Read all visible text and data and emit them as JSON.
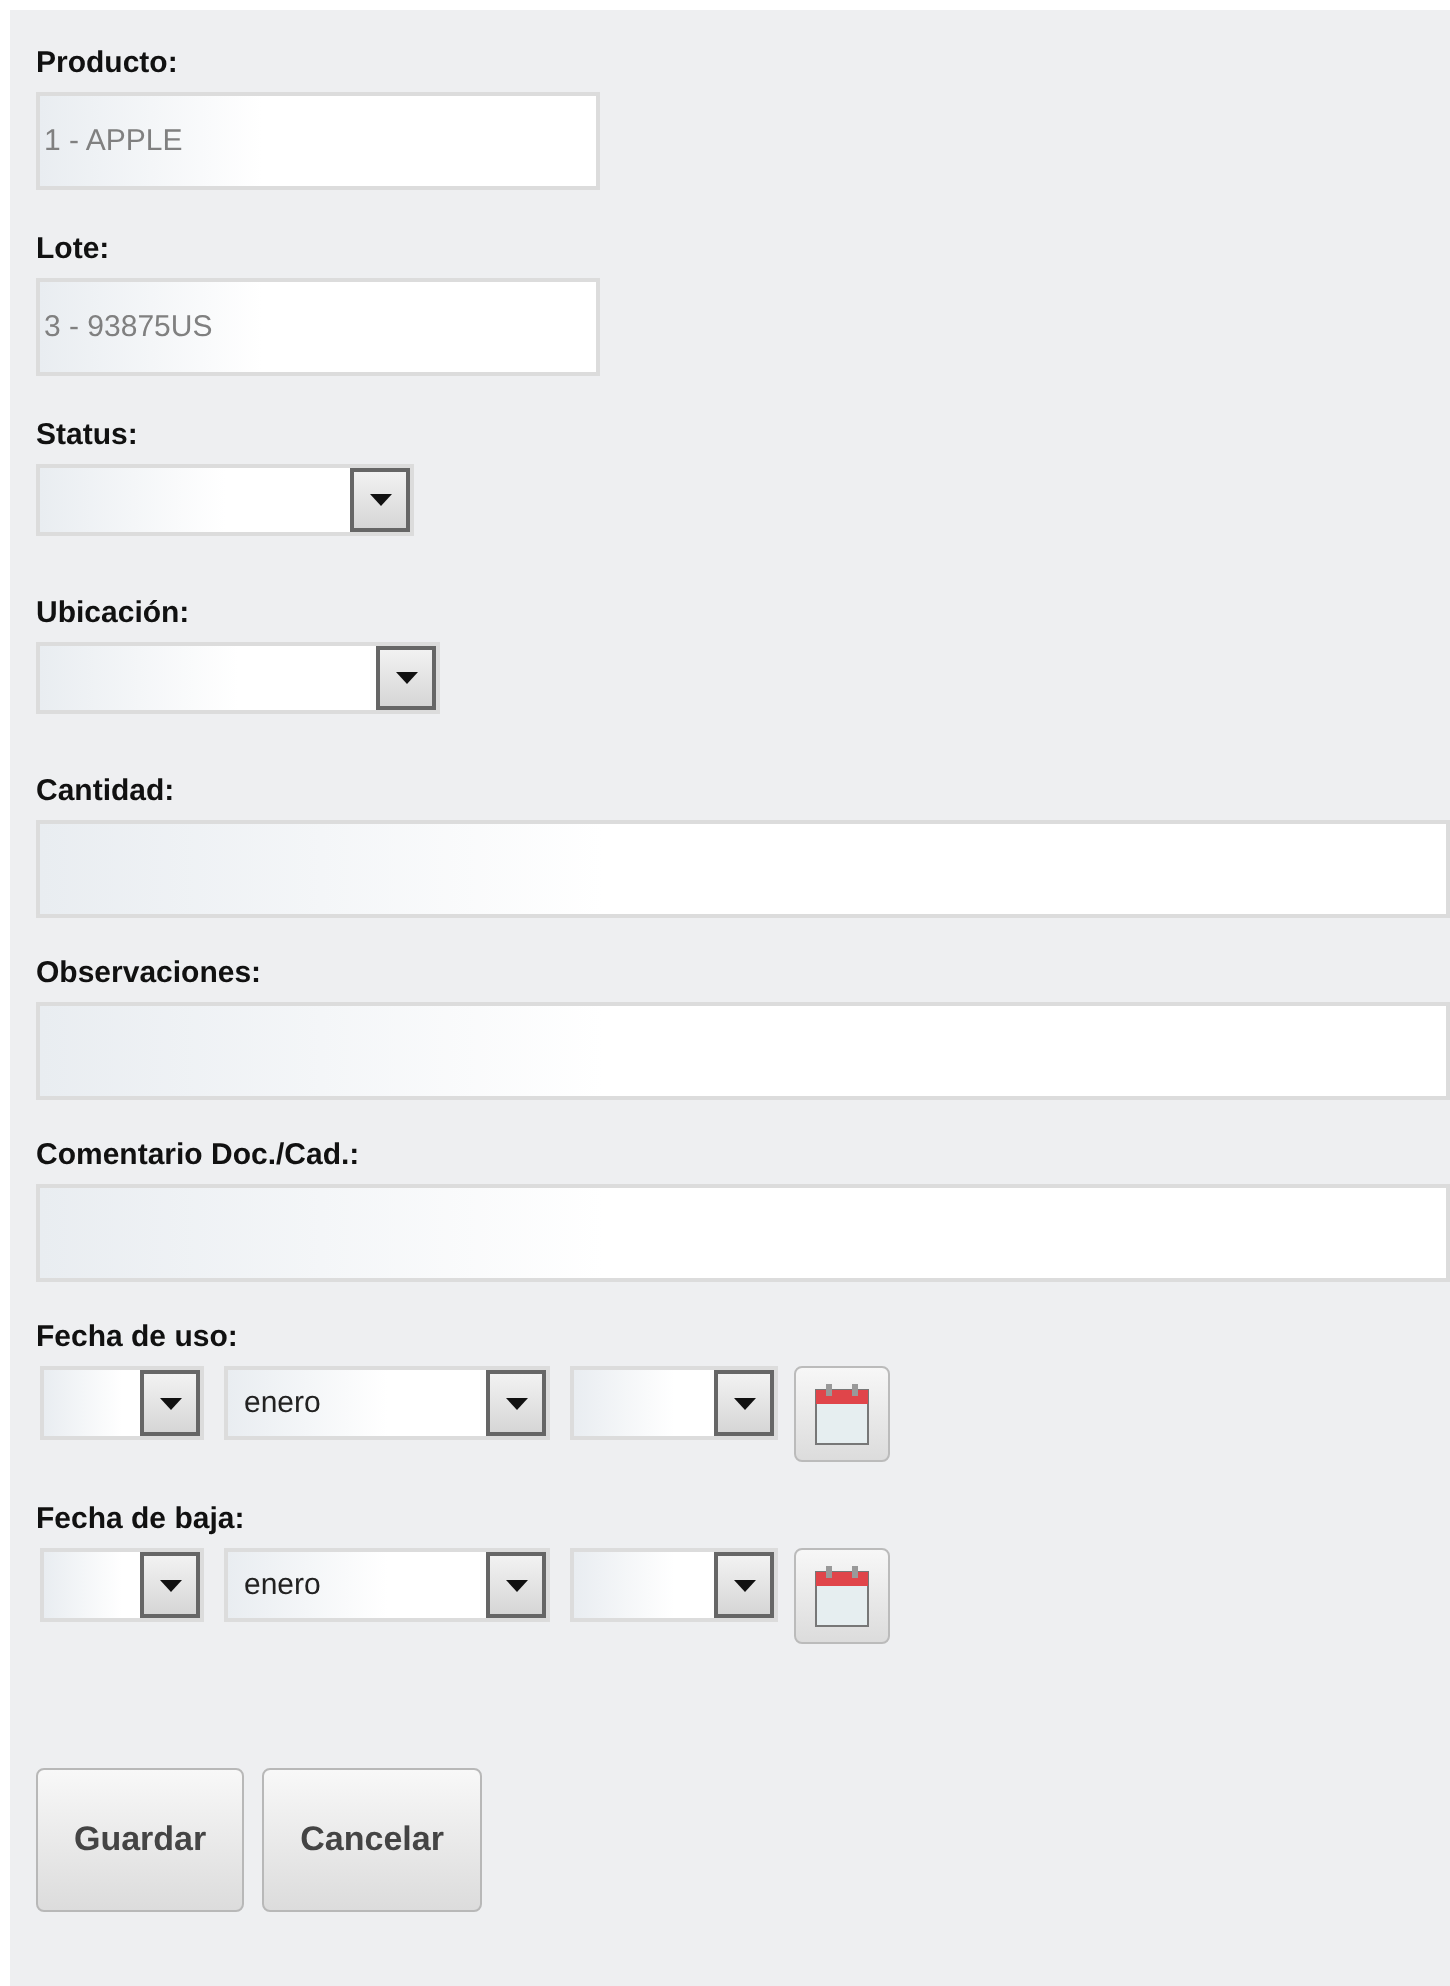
{
  "fields": [
    {
      "kind": "text",
      "label": "Producto:",
      "value": "1 - APPLE",
      "disabled": true
    },
    {
      "kind": "text",
      "label": "Lote:",
      "value": "3 - 93875US",
      "disabled": true
    },
    {
      "kind": "select",
      "label": "Status:"
    },
    {
      "kind": "select",
      "label": "Ubicación:"
    },
    {
      "kind": "text",
      "label": "Cantidad:",
      "disabled": false
    },
    {
      "kind": "text",
      "label": "Observaciones:",
      "disabled": false
    },
    {
      "kind": "text",
      "label": "Comentario Doc./Cad.:",
      "disabled": false
    },
    {
      "kind": "date",
      "label": "Fecha de uso:",
      "month": "enero"
    },
    {
      "kind": "date",
      "label": "Fecha de baja:",
      "month": "enero"
    }
  ],
  "buttons": [
    "Guardar",
    "Cancelar"
  ]
}
